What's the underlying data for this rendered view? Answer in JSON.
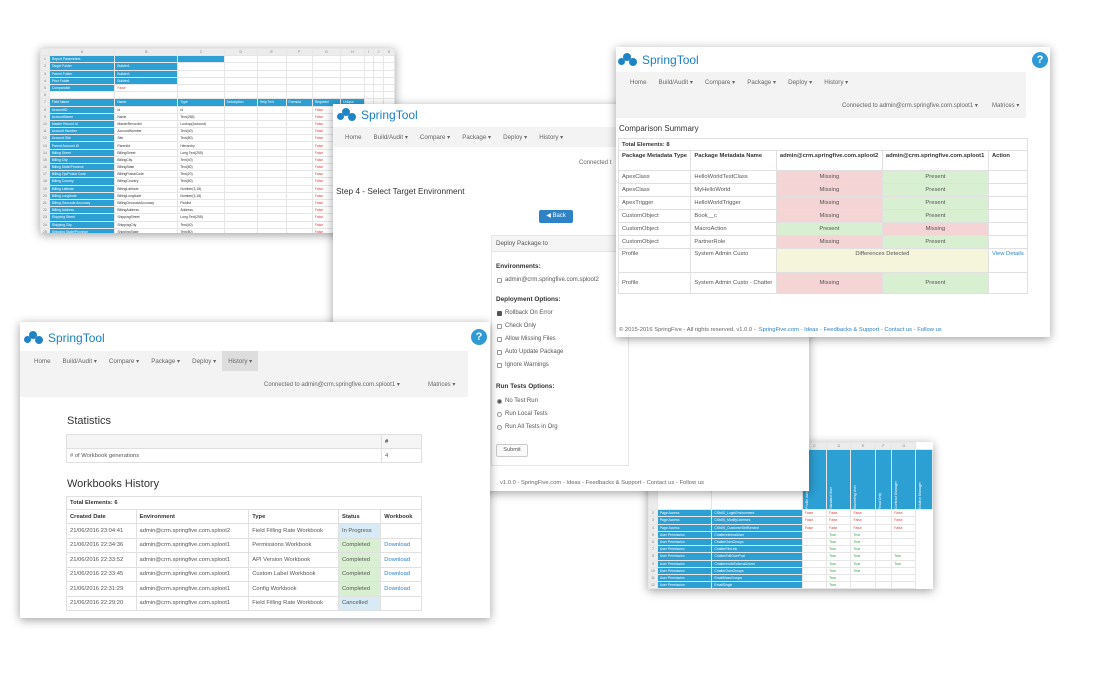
{
  "brand": {
    "name": "SpringTool",
    "accent": "#1f84c6",
    "help": "?"
  },
  "nav": {
    "home": "Home",
    "build": "Build/Audit ▾",
    "compare": "Compare ▾",
    "package": "Package ▾",
    "deploy": "Deploy ▾",
    "history": "History ▾",
    "connected": "Connected to admin@crm.springfive.com.sploot1 ▾",
    "connected_short": "Connected t",
    "matrices": "Matrices ▾"
  },
  "spreadsheet_tl": {
    "col_letters": [
      "A",
      "B",
      "C",
      "D",
      "E",
      "F",
      "G",
      "H",
      "I",
      "J",
      "K"
    ],
    "rows": [
      [
        "Report Parameters",
        "",
        "",
        "",
        "",
        "",
        "",
        "",
        "",
        ""
      ],
      [
        "Target Folder",
        "Builder1",
        "",
        "",
        "",
        "",
        "",
        "",
        "",
        ""
      ],
      [
        "Parent Folder",
        "Builder1",
        "",
        "",
        "",
        "",
        "",
        "",
        "",
        ""
      ],
      [
        "Prior Folder",
        "Builder1",
        "",
        "",
        "",
        "",
        "",
        "",
        "",
        ""
      ],
      [
        "Comparable",
        "False",
        "",
        "",
        "",
        "",
        "",
        "",
        "",
        ""
      ],
      [
        "",
        "",
        "",
        "",
        "",
        "",
        "",
        "",
        "",
        ""
      ],
      [
        "Field Name",
        "Name",
        "Type",
        "Description",
        "Help Text",
        "Formula",
        "Required",
        "Unique",
        ""
      ],
      [
        "AccountID",
        "Id",
        "Id",
        "",
        "",
        "",
        "False",
        "False",
        ""
      ],
      [
        "AccountName",
        "Name",
        "Text(255)",
        "",
        "",
        "",
        "False",
        "False",
        ""
      ],
      [
        "Master Record Id",
        "MasterRecordId",
        "Lookup(Account)",
        "",
        "",
        "",
        "False",
        "False",
        ""
      ],
      [
        "Account Number",
        "AccountNumber",
        "Text(40)",
        "",
        "",
        "",
        "False",
        "False",
        ""
      ],
      [
        "Account Site",
        "Site",
        "Text(80)",
        "",
        "",
        "",
        "False",
        "False",
        ""
      ],
      [
        "Parent Account ID",
        "ParentId",
        "Hierarchy",
        "",
        "",
        "",
        "False",
        "False",
        ""
      ],
      [
        "Billing Street",
        "BillingStreet",
        "Long Text(255)",
        "",
        "",
        "",
        "False",
        "False",
        ""
      ],
      [
        "Billing City",
        "BillingCity",
        "Text(40)",
        "",
        "",
        "",
        "False",
        "False",
        ""
      ],
      [
        "Billing State/Province",
        "BillingState",
        "Text(80)",
        "",
        "",
        "",
        "False",
        "False",
        ""
      ],
      [
        "Billing Zip/Postal Code",
        "BillingPostalCode",
        "Text(20)",
        "",
        "",
        "",
        "False",
        "False",
        ""
      ],
      [
        "Billing Country",
        "BillingCountry",
        "Text(80)",
        "",
        "",
        "",
        "False",
        "False",
        ""
      ],
      [
        "Billing Latitude",
        "BillingLatitude",
        "Number(3,15)",
        "",
        "",
        "",
        "False",
        "False",
        ""
      ],
      [
        "Billing Longitude",
        "BillingLongitude",
        "Number(3,15)",
        "",
        "",
        "",
        "False",
        "False",
        ""
      ],
      [
        "Billing Geocode Accuracy",
        "BillingGeocodeAccuracy",
        "Picklist",
        "",
        "",
        "",
        "False",
        "False",
        ""
      ],
      [
        "Billing Address",
        "BillingAddress",
        "Address",
        "",
        "",
        "",
        "False",
        "False",
        ""
      ],
      [
        "Shipping Street",
        "ShippingStreet",
        "Long Text(255)",
        "",
        "",
        "",
        "False",
        "False",
        ""
      ],
      [
        "Shipping City",
        "ShippingCity",
        "Text(40)",
        "",
        "",
        "",
        "False",
        "False",
        ""
      ],
      [
        "Shipping State/Province",
        "ShippingState",
        "Text(80)",
        "",
        "",
        "",
        "False",
        "False",
        ""
      ],
      [
        "Shipping Zip/Postal Code",
        "ShippingPostalCode",
        "Text(20)",
        "",
        "",
        "",
        "False",
        "False",
        ""
      ]
    ]
  },
  "deploy": {
    "step": "Step 4 - Select Target Environment",
    "back": "◀ Back",
    "panel_title": "Deploy Package to",
    "env_label": "Environments:",
    "env_option": "admin@crm.springfive.com.sploot2",
    "options_label": "Deployment Options:",
    "options": [
      {
        "label": "Rollback On Error",
        "checked": true
      },
      {
        "label": "Check Only",
        "checked": false
      },
      {
        "label": "Allow Missing Files",
        "checked": false
      },
      {
        "label": "Auto Update Package",
        "checked": false
      },
      {
        "label": "Ignore Warnings",
        "checked": false
      }
    ],
    "tests_label": "Run Tests Options:",
    "tests": [
      "No Test Run",
      "Run Local Tests",
      "Run All Tests in Org"
    ],
    "submit": "Submit",
    "footer": "v1.0.0 - SpringFive.com - Ideas - Feedbacks & Support - Contact us - Follow us"
  },
  "compare": {
    "title": "Comparison Summary",
    "total": "Total Elements: 8",
    "headers": [
      "Package Metadata Type",
      "Package Metadata Name",
      "admin@crm.springfive.com.sploot2",
      "admin@crm.springfive.com.sploot1",
      "Action"
    ],
    "rows": [
      [
        "ApexClass",
        "HelloWorldTestClass",
        "Missing",
        "Present",
        ""
      ],
      [
        "ApexClass",
        "MyHelloWorld",
        "Missing",
        "Present",
        ""
      ],
      [
        "ApexTrigger",
        "HelloWorldTrigger",
        "Missing",
        "Present",
        ""
      ],
      [
        "CustomObject",
        "Book__c",
        "Missing",
        "Present",
        ""
      ],
      [
        "CustomObject",
        "MacroAction",
        "Present",
        "Missing",
        ""
      ],
      [
        "CustomObject",
        "PartnerRole",
        "Missing",
        "Present",
        ""
      ],
      [
        "Profile",
        "System Admin Custo",
        "Differences Detected",
        "",
        "View Details"
      ],
      [
        "Profile",
        "System Admin Custo - Chatter",
        "Missing",
        "Present",
        ""
      ]
    ],
    "footer_copy": "© 2015-2016 SpringFive - All rights reserved. v1.0.0 -",
    "footer_links": "SpringFive.com - Ideas - Feedbacks & Support - Contact us - Follow us"
  },
  "history": {
    "stats_title": "Statistics",
    "stats_head": "#",
    "stats_row": [
      "# of Workbook generations",
      "4"
    ],
    "wb_title": "Workbooks History",
    "total": "Total Elements: 6",
    "headers": [
      "Created Date",
      "Environment",
      "Type",
      "Status",
      "Workbook"
    ],
    "rows": [
      [
        "21/06/2016 23:04:41",
        "admin@crm.springfive.com.sploot2",
        "Field Filling Rate Workbook",
        "In Progress",
        ""
      ],
      [
        "21/06/2016 22:34:36",
        "admin@crm.springfive.com.sploot1",
        "Permissions Workbook",
        "Completed",
        "Download"
      ],
      [
        "21/06/2016 22:33:52",
        "admin@crm.springfive.com.sploot1",
        "API Version Workbook",
        "Completed",
        "Download"
      ],
      [
        "21/06/2016 22:33:45",
        "admin@crm.springfive.com.sploot1",
        "Custom Label Workbook",
        "Completed",
        "Download"
      ],
      [
        "21/06/2016 22:31:29",
        "admin@crm.springfive.com.sploot1",
        "Config Workbook",
        "Completed",
        "Download"
      ],
      [
        "21/06/2016 22:29:20",
        "admin@crm.springfive.com.sploot1",
        "Field Filling Rate Workbook",
        "Cancelled",
        ""
      ]
    ]
  },
  "spreadsheet_br": {
    "col_letters": [
      "",
      "A",
      "B",
      "C",
      "D",
      "E",
      "F",
      "G"
    ],
    "vheaders": [
      "Profile Admin Custo",
      "Standard User",
      "Marketing User",
      "Read Only",
      "Contract Manager",
      "Solution Manager"
    ],
    "first_header": [
      "Permission Type",
      "Name",
      "",
      "",
      "",
      "",
      "",
      ""
    ],
    "rows": [
      [
        "Page Access",
        "CStdIS_LoginEnvironment",
        "False",
        "False",
        "False",
        "",
        "False"
      ],
      [
        "Page Access",
        "CStdIS_ModifyLicenses",
        "False",
        "False",
        "False",
        "",
        "False"
      ],
      [
        "Page Access",
        "CStdIS_CustomerSelfService",
        "False",
        "False",
        "False",
        "",
        "False"
      ],
      [
        "User Permission",
        "ChatterInternalUser",
        "",
        "True",
        "True",
        "",
        ""
      ],
      [
        "User Permission",
        "ChatterOwnGroups",
        "",
        "True",
        "True",
        "",
        ""
      ],
      [
        "User Permission",
        "ChatterFileLink",
        "",
        "True",
        "True",
        "",
        ""
      ],
      [
        "User Permission",
        "ChatterEditOwnPost",
        "",
        "True",
        "True",
        "",
        "True"
      ],
      [
        "User Permission",
        "ChatterInviteExternalUsers",
        "",
        "True",
        "True",
        "",
        "True"
      ],
      [
        "User Permission",
        "ChatterOwnGroups",
        "",
        "True",
        "True",
        "",
        ""
      ],
      [
        "User Permission",
        "EmailMassGroups",
        "",
        "True",
        "",
        "",
        ""
      ],
      [
        "User Permission",
        "EmailSingle",
        "",
        "True",
        "",
        "",
        ""
      ],
      [
        "User Permission",
        "EnableNotifications",
        "",
        "",
        "",
        "",
        "True"
      ]
    ]
  }
}
